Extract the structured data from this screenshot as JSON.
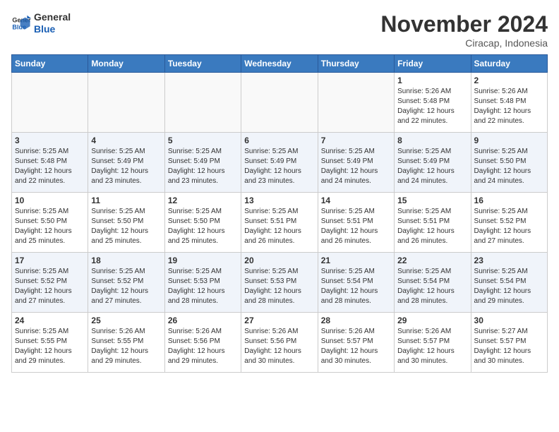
{
  "header": {
    "logo_line1": "General",
    "logo_line2": "Blue",
    "month": "November 2024",
    "location": "Ciracap, Indonesia"
  },
  "weekdays": [
    "Sunday",
    "Monday",
    "Tuesday",
    "Wednesday",
    "Thursday",
    "Friday",
    "Saturday"
  ],
  "weeks": [
    [
      {
        "day": "",
        "info": ""
      },
      {
        "day": "",
        "info": ""
      },
      {
        "day": "",
        "info": ""
      },
      {
        "day": "",
        "info": ""
      },
      {
        "day": "",
        "info": ""
      },
      {
        "day": "1",
        "info": "Sunrise: 5:26 AM\nSunset: 5:48 PM\nDaylight: 12 hours and 22 minutes."
      },
      {
        "day": "2",
        "info": "Sunrise: 5:26 AM\nSunset: 5:48 PM\nDaylight: 12 hours and 22 minutes."
      }
    ],
    [
      {
        "day": "3",
        "info": "Sunrise: 5:25 AM\nSunset: 5:48 PM\nDaylight: 12 hours and 22 minutes."
      },
      {
        "day": "4",
        "info": "Sunrise: 5:25 AM\nSunset: 5:49 PM\nDaylight: 12 hours and 23 minutes."
      },
      {
        "day": "5",
        "info": "Sunrise: 5:25 AM\nSunset: 5:49 PM\nDaylight: 12 hours and 23 minutes."
      },
      {
        "day": "6",
        "info": "Sunrise: 5:25 AM\nSunset: 5:49 PM\nDaylight: 12 hours and 23 minutes."
      },
      {
        "day": "7",
        "info": "Sunrise: 5:25 AM\nSunset: 5:49 PM\nDaylight: 12 hours and 24 minutes."
      },
      {
        "day": "8",
        "info": "Sunrise: 5:25 AM\nSunset: 5:49 PM\nDaylight: 12 hours and 24 minutes."
      },
      {
        "day": "9",
        "info": "Sunrise: 5:25 AM\nSunset: 5:50 PM\nDaylight: 12 hours and 24 minutes."
      }
    ],
    [
      {
        "day": "10",
        "info": "Sunrise: 5:25 AM\nSunset: 5:50 PM\nDaylight: 12 hours and 25 minutes."
      },
      {
        "day": "11",
        "info": "Sunrise: 5:25 AM\nSunset: 5:50 PM\nDaylight: 12 hours and 25 minutes."
      },
      {
        "day": "12",
        "info": "Sunrise: 5:25 AM\nSunset: 5:50 PM\nDaylight: 12 hours and 25 minutes."
      },
      {
        "day": "13",
        "info": "Sunrise: 5:25 AM\nSunset: 5:51 PM\nDaylight: 12 hours and 26 minutes."
      },
      {
        "day": "14",
        "info": "Sunrise: 5:25 AM\nSunset: 5:51 PM\nDaylight: 12 hours and 26 minutes."
      },
      {
        "day": "15",
        "info": "Sunrise: 5:25 AM\nSunset: 5:51 PM\nDaylight: 12 hours and 26 minutes."
      },
      {
        "day": "16",
        "info": "Sunrise: 5:25 AM\nSunset: 5:52 PM\nDaylight: 12 hours and 27 minutes."
      }
    ],
    [
      {
        "day": "17",
        "info": "Sunrise: 5:25 AM\nSunset: 5:52 PM\nDaylight: 12 hours and 27 minutes."
      },
      {
        "day": "18",
        "info": "Sunrise: 5:25 AM\nSunset: 5:52 PM\nDaylight: 12 hours and 27 minutes."
      },
      {
        "day": "19",
        "info": "Sunrise: 5:25 AM\nSunset: 5:53 PM\nDaylight: 12 hours and 28 minutes."
      },
      {
        "day": "20",
        "info": "Sunrise: 5:25 AM\nSunset: 5:53 PM\nDaylight: 12 hours and 28 minutes."
      },
      {
        "day": "21",
        "info": "Sunrise: 5:25 AM\nSunset: 5:54 PM\nDaylight: 12 hours and 28 minutes."
      },
      {
        "day": "22",
        "info": "Sunrise: 5:25 AM\nSunset: 5:54 PM\nDaylight: 12 hours and 28 minutes."
      },
      {
        "day": "23",
        "info": "Sunrise: 5:25 AM\nSunset: 5:54 PM\nDaylight: 12 hours and 29 minutes."
      }
    ],
    [
      {
        "day": "24",
        "info": "Sunrise: 5:25 AM\nSunset: 5:55 PM\nDaylight: 12 hours and 29 minutes."
      },
      {
        "day": "25",
        "info": "Sunrise: 5:26 AM\nSunset: 5:55 PM\nDaylight: 12 hours and 29 minutes."
      },
      {
        "day": "26",
        "info": "Sunrise: 5:26 AM\nSunset: 5:56 PM\nDaylight: 12 hours and 29 minutes."
      },
      {
        "day": "27",
        "info": "Sunrise: 5:26 AM\nSunset: 5:56 PM\nDaylight: 12 hours and 30 minutes."
      },
      {
        "day": "28",
        "info": "Sunrise: 5:26 AM\nSunset: 5:57 PM\nDaylight: 12 hours and 30 minutes."
      },
      {
        "day": "29",
        "info": "Sunrise: 5:26 AM\nSunset: 5:57 PM\nDaylight: 12 hours and 30 minutes."
      },
      {
        "day": "30",
        "info": "Sunrise: 5:27 AM\nSunset: 5:57 PM\nDaylight: 12 hours and 30 minutes."
      }
    ]
  ]
}
